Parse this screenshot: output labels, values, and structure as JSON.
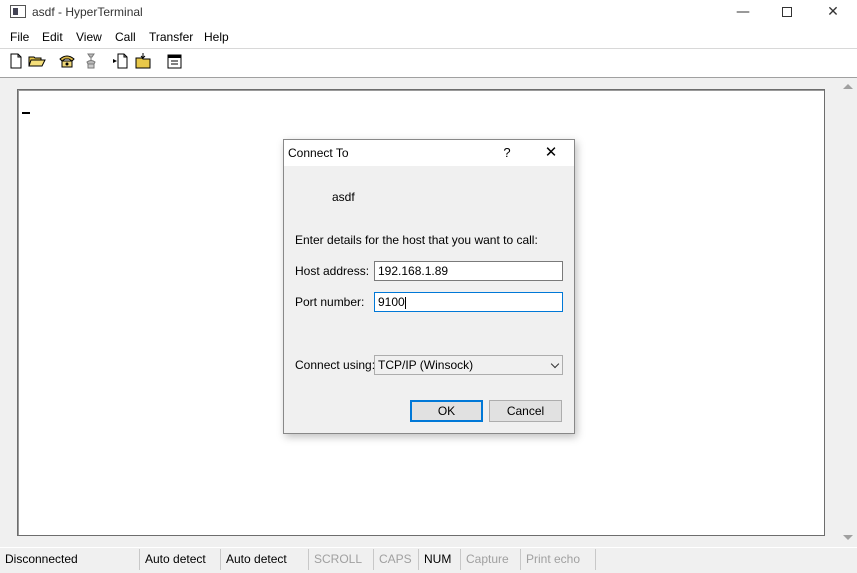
{
  "window": {
    "title": "asdf - HyperTerminal",
    "minimize_glyph": "—",
    "close_glyph": "✕"
  },
  "menu": [
    "File",
    "Edit",
    "View",
    "Call",
    "Transfer",
    "Help"
  ],
  "toolbar": {
    "icons": [
      "new-file-icon",
      "open-folder-icon",
      "phone-icon",
      "disconnect-phone-icon",
      "send-file-icon",
      "receive-file-icon",
      "properties-icon"
    ]
  },
  "dialog": {
    "title": "Connect To",
    "help_glyph": "?",
    "close_glyph": "✕",
    "connection_name": "asdf",
    "prompt": "Enter details for the host that you want to call:",
    "host_label": "Host address:",
    "host_value": "192.168.1.89",
    "port_label": "Port number:",
    "port_value": "9100",
    "connect_label": "Connect using:",
    "connect_value": "TCP/IP (Winsock)",
    "ok_label": "OK",
    "cancel_label": "Cancel"
  },
  "status": [
    {
      "text": "Disconnected",
      "enabled": true
    },
    {
      "text": "Auto detect",
      "enabled": true
    },
    {
      "text": "Auto detect",
      "enabled": true
    },
    {
      "text": "SCROLL",
      "enabled": false
    },
    {
      "text": "CAPS",
      "enabled": false
    },
    {
      "text": "NUM",
      "enabled": true
    },
    {
      "text": "Capture",
      "enabled": false
    },
    {
      "text": "Print echo",
      "enabled": false
    }
  ]
}
